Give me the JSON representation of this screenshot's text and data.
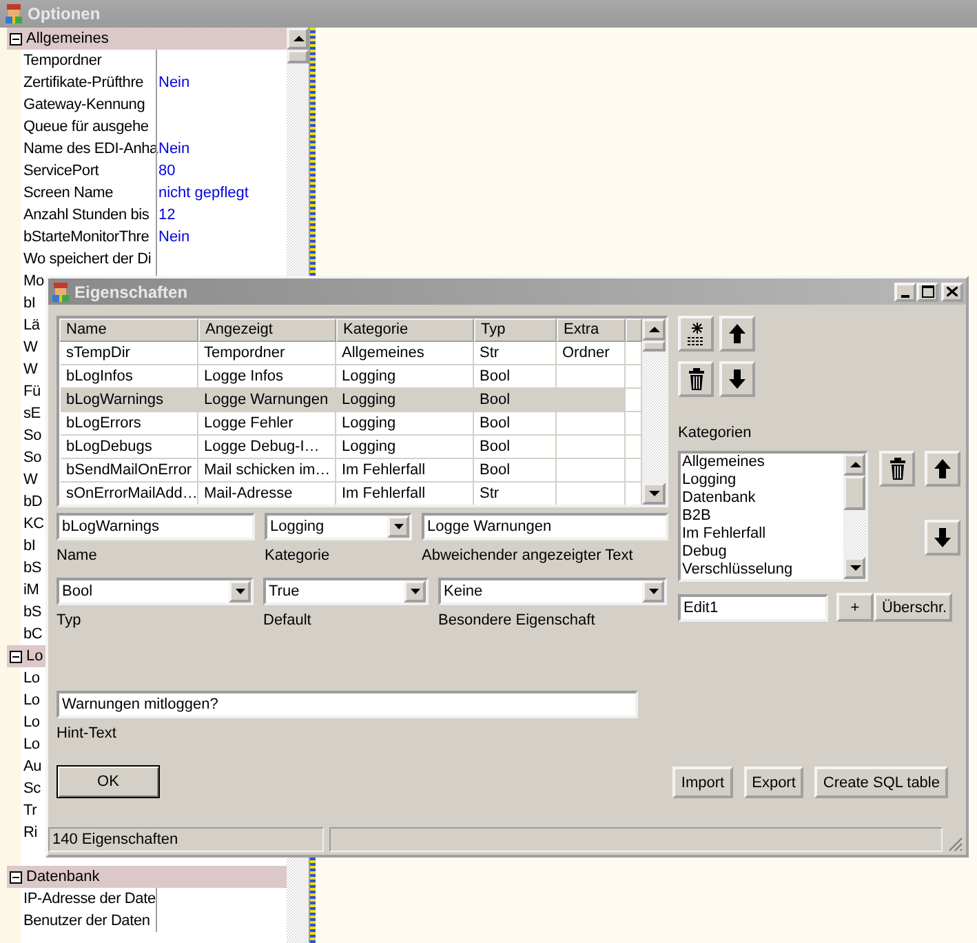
{
  "main_window": {
    "title": "Optionen"
  },
  "option_groups": [
    {
      "label": "Allgemeines",
      "expanded": true,
      "options": [
        {
          "name": "Tempordner"
        },
        {
          "name": "Zertifikate-Prüfthre",
          "value": "Nein"
        },
        {
          "name": "Gateway-Kennung"
        },
        {
          "name": "Queue für ausgehe"
        },
        {
          "name": "Name des EDI-Anha",
          "value": "Nein"
        },
        {
          "name": "ServicePort",
          "value": "80"
        },
        {
          "name": "Screen Name",
          "value": "nicht gepflegt"
        },
        {
          "name": "Anzahl Stunden bis",
          "value": "12"
        },
        {
          "name": "bStarteMonitorThre",
          "value": "Nein"
        },
        {
          "name": "Wo speichert der Di"
        },
        {
          "name": "Mo"
        },
        {
          "name": "bI"
        },
        {
          "name": "Lä"
        },
        {
          "name": "W"
        },
        {
          "name": "W"
        },
        {
          "name": "Fü"
        },
        {
          "name": "sE"
        },
        {
          "name": "So"
        },
        {
          "name": "So"
        },
        {
          "name": "W"
        },
        {
          "name": "bD"
        },
        {
          "name": "KC"
        },
        {
          "name": "bI"
        },
        {
          "name": "bS"
        },
        {
          "name": "iM"
        },
        {
          "name": "bS"
        },
        {
          "name": "bC"
        }
      ]
    },
    {
      "label": "Lo",
      "expanded": true,
      "options": [
        {
          "name": "Lo"
        },
        {
          "name": "Lo"
        },
        {
          "name": "Lo"
        },
        {
          "name": "Lo"
        },
        {
          "name": "Au"
        },
        {
          "name": "Sc"
        },
        {
          "name": "Tr"
        },
        {
          "name": "Ri"
        }
      ]
    },
    {
      "label": "Datenbank",
      "expanded": true,
      "options": [
        {
          "name": "IP-Adresse der Date"
        },
        {
          "name": "Benutzer der Daten"
        }
      ]
    }
  ],
  "dialog": {
    "title": "Eigenschaften",
    "table": {
      "columns": [
        "Name",
        "Angezeigt",
        "Kategorie",
        "Typ",
        "Extra"
      ],
      "rows": [
        {
          "cells": [
            "sTempDir",
            "Tempordner",
            "Allgemeines",
            "Str",
            "Ordner"
          ],
          "selected": false
        },
        {
          "cells": [
            "bLogInfos",
            "Logge Infos",
            "Logging",
            "Bool"
          ],
          "selected": false
        },
        {
          "cells": [
            "bLogWarnings",
            "Logge Warnungen",
            "Logging",
            "Bool"
          ],
          "selected": true
        },
        {
          "cells": [
            "bLogErrors",
            "Logge Fehler",
            "Logging",
            "Bool"
          ],
          "selected": false
        },
        {
          "cells": [
            "bLogDebugs",
            "Logge Debug-I…",
            "Logging",
            "Bool"
          ],
          "selected": false
        },
        {
          "cells": [
            "bSendMailOnError",
            "Mail schicken im…",
            "Im Fehlerfall",
            "Bool"
          ],
          "selected": false
        },
        {
          "cells": [
            "sOnErrorMailAdd…",
            "Mail-Adresse",
            "Im Fehlerfall",
            "Str"
          ],
          "selected": false
        }
      ]
    },
    "field_rows": [
      [
        {
          "kind": "text",
          "value": "bLogWarnings",
          "label": "Name"
        },
        {
          "kind": "dropdown",
          "value": "Logging",
          "label": "Kategorie"
        },
        {
          "kind": "text",
          "value": "Logge Warnungen",
          "label": "Abweichender angezeigter Text"
        }
      ],
      [
        {
          "kind": "dropdown",
          "value": "Bool",
          "label": "Typ"
        },
        {
          "kind": "dropdown",
          "value": "True",
          "label": "Default"
        },
        {
          "kind": "dropdown",
          "value": "Keine",
          "label": "Besondere Eigenschaft"
        }
      ],
      [
        {
          "kind": "text",
          "value": "Warnungen mitloggen?",
          "label": "Hint-Text"
        }
      ]
    ],
    "categories_label": "Kategorien",
    "categories": [
      "Allgemeines",
      "Logging",
      "Datenbank",
      "B2B",
      "Im Fehlerfall",
      "Debug",
      "Verschlüsselung"
    ],
    "category_input": {
      "value": "Edit1"
    },
    "category_buttons": [
      "+",
      "Überschr."
    ],
    "ok_button": "OK",
    "action_buttons": [
      "Import",
      "Export",
      "Create SQL table"
    ],
    "status": "140 Eigenschaften"
  }
}
